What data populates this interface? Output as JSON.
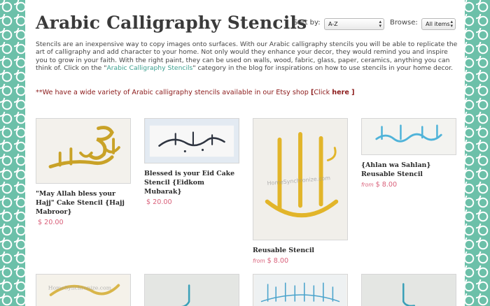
{
  "page": {
    "title": "Arabic Calligraphy Stencils",
    "sort_label": "Sort by:",
    "sort_value": "A-Z",
    "browse_label": "Browse:",
    "browse_value": "All items",
    "intro_part1": "Stencils are an inexpensive way to copy images onto surfaces. With our Arabic calligraphy stencils you will be able to replicate the art of calligraphy and add character to your home. Not only would they enhance your decor, they would remind you and inspire you to grow in your faith. With the right paint, they can be used on walls, wood, fabric, glass, paper, ceramics, anything you can think of. Click on the \"",
    "intro_link": "Arabic Calligraphy Stencils",
    "intro_part2": "\" category in the blog for inspirations on how to use stencils in your home decor.",
    "etsy_text": "**We have a wide variety of Arabic calligraphy stencils available in our Etsy shop ",
    "etsy_bracket_open": "[",
    "etsy_click": "Click ",
    "etsy_link": "here",
    "etsy_bracket_close": " ]"
  },
  "products": [
    {
      "name": "\"May Allah bless your Hajj\" Cake Stencil {Hajj Mabroor}",
      "price": "$ 20.00",
      "from": "",
      "image": "gold-calligraphy-hajj-mabroor",
      "ink": "#c9a227"
    },
    {
      "name": "Blessed is your Eid Cake Stencil {Eidkom Mubarak}",
      "price": "$ 20.00",
      "from": "",
      "image": "dark-calligraphy-eid-mubarak",
      "ink": "#2e3440"
    },
    {
      "name": "Reusable Stencil",
      "price": "$ 8.00",
      "from": "from",
      "image": "yellow-calligraphy-allah",
      "ink": "#e2b52a",
      "watermark": "HomeSynchronize.com"
    },
    {
      "name": "{Ahlan wa Sahlan} Reusable Stencil",
      "price": "$ 8.00",
      "from": "from",
      "image": "blue-calligraphy-ahlan-wa-sahlan",
      "ink": "#4fb3d9"
    },
    {
      "name": "",
      "price": "",
      "from": "",
      "image": "gold-calligraphy-partial",
      "ink": "#d9b64a",
      "watermark": "HomeSynchronize.com"
    },
    {
      "name": "",
      "price": "",
      "from": "",
      "image": "teal-calligraphy-partial",
      "ink": "#3aa0b8"
    },
    {
      "name": "",
      "price": "",
      "from": "",
      "image": "blue-calligraphy-pattern-partial",
      "ink": "#4aa3cc"
    },
    {
      "name": "",
      "price": "",
      "from": "",
      "image": "teal-calligraphy-partial-2",
      "ink": "#3aa0b8"
    }
  ]
}
